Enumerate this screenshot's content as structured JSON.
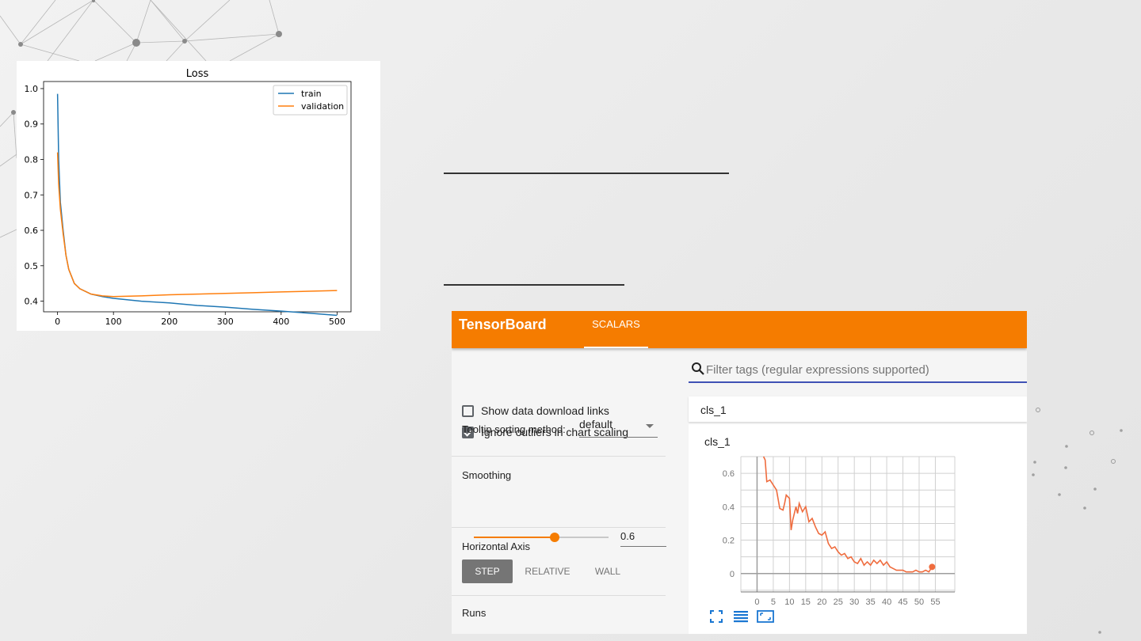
{
  "loss_chart": {
    "chart_data": {
      "type": "line",
      "title": "Loss",
      "xlabel": "",
      "ylabel": "",
      "xlim": [
        -25,
        525
      ],
      "ylim": [
        0.37,
        1.02
      ],
      "x_ticks": [
        "0",
        "100",
        "200",
        "300",
        "400",
        "500"
      ],
      "y_ticks": [
        "0.4",
        "0.5",
        "0.6",
        "0.7",
        "0.8",
        "0.9",
        "1.0"
      ],
      "legend_position": "top-right",
      "grid": false,
      "series": [
        {
          "name": "train",
          "color": "#1f77b4",
          "x": [
            0,
            2,
            5,
            10,
            15,
            20,
            30,
            40,
            60,
            80,
            100,
            150,
            200,
            250,
            300,
            350,
            400,
            450,
            500
          ],
          "y": [
            0.985,
            0.8,
            0.68,
            0.6,
            0.53,
            0.49,
            0.45,
            0.435,
            0.42,
            0.413,
            0.408,
            0.4,
            0.395,
            0.388,
            0.383,
            0.377,
            0.372,
            0.366,
            0.36
          ]
        },
        {
          "name": "validation",
          "color": "#ff7f0e",
          "x": [
            0,
            2,
            5,
            10,
            15,
            20,
            30,
            40,
            60,
            80,
            100,
            150,
            200,
            250,
            300,
            350,
            400,
            450,
            500
          ],
          "y": [
            0.82,
            0.73,
            0.66,
            0.59,
            0.53,
            0.49,
            0.45,
            0.435,
            0.42,
            0.415,
            0.413,
            0.415,
            0.418,
            0.42,
            0.422,
            0.424,
            0.426,
            0.428,
            0.43
          ]
        }
      ]
    }
  },
  "tensorboard": {
    "title": "TensorBoard",
    "tab": "SCALARS",
    "show_download_label": "Show data download links",
    "ignore_outliers_label": "Ignore outliers in chart scaling",
    "tooltip_label": "Tooltip sorting method:",
    "tooltip_value": "default",
    "smoothing_label": "Smoothing",
    "smoothing_value": "0.6",
    "smoothing_fraction": 0.6,
    "horizontal_axis_label": "Horizontal Axis",
    "axis_buttons": [
      "STEP",
      "RELATIVE",
      "WALL"
    ],
    "runs_label": "Runs",
    "search_placeholder": "Filter tags (regular expressions supported)",
    "tag_group": "cls_1",
    "card_title": "cls_1",
    "accent_color": "#f57c00",
    "icons": [
      "fullscreen-icon",
      "data-table-icon",
      "fit-domain-icon"
    ],
    "chart_data": {
      "type": "line",
      "title": "cls_1",
      "xlim": [
        -5,
        61
      ],
      "ylim": [
        -0.11,
        0.7
      ],
      "x_ticks": [
        "0",
        "5",
        "10",
        "15",
        "20",
        "25",
        "30",
        "35",
        "40",
        "45",
        "50",
        "55"
      ],
      "y_ticks": [
        "0",
        "0.2",
        "0.4",
        "0.6"
      ],
      "grid": true,
      "series": [
        {
          "name": "",
          "color": "#ef6c3e",
          "x": [
            2,
            2.5,
            3,
            4,
            5,
            6,
            7,
            8,
            8.5,
            9,
            10,
            10.5,
            11,
            12,
            12.5,
            13,
            14,
            15,
            16,
            17,
            18,
            19,
            20,
            21,
            22,
            23,
            24,
            25,
            26,
            27,
            28,
            29,
            30,
            31,
            32,
            33,
            34,
            35,
            36,
            37,
            38,
            39,
            40,
            41,
            42,
            43,
            44,
            45,
            46,
            47,
            48,
            49,
            50,
            51,
            52,
            53,
            54
          ],
          "y": [
            0.73,
            0.68,
            0.55,
            0.56,
            0.53,
            0.5,
            0.39,
            0.38,
            0.42,
            0.47,
            0.45,
            0.26,
            0.32,
            0.4,
            0.36,
            0.42,
            0.37,
            0.4,
            0.31,
            0.33,
            0.28,
            0.24,
            0.23,
            0.25,
            0.18,
            0.15,
            0.16,
            0.13,
            0.11,
            0.12,
            0.09,
            0.1,
            0.07,
            0.06,
            0.09,
            0.05,
            0.07,
            0.05,
            0.08,
            0.06,
            0.08,
            0.05,
            0.07,
            0.04,
            0.03,
            0.02,
            0.02,
            0.02,
            0.01,
            0.01,
            0.01,
            0.02,
            0.01,
            0.01,
            0.02,
            0.01,
            0.04
          ]
        }
      ]
    }
  }
}
